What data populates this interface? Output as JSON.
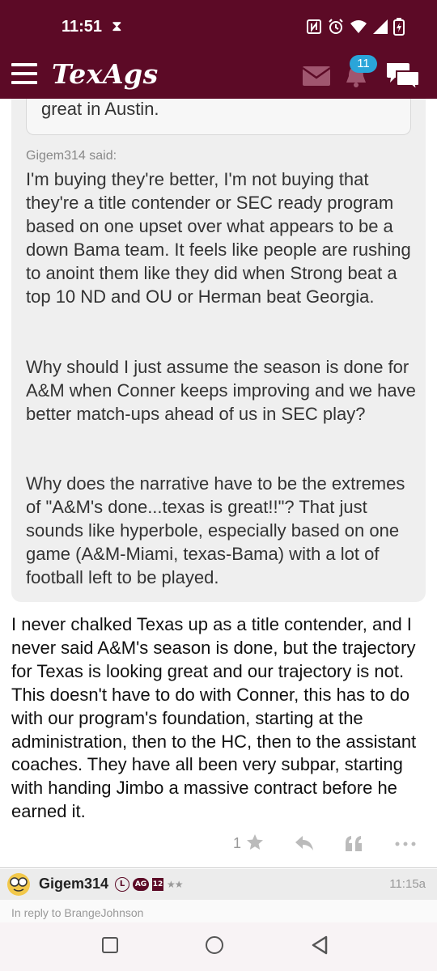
{
  "status_bar": {
    "time": "11:51",
    "hourglass_icon": "hourglass-icon",
    "icons": [
      "nfc-icon",
      "alarm-icon",
      "wifi-icon",
      "signal-icon",
      "battery-charging-icon"
    ]
  },
  "app_bar": {
    "logo": "TexAgs",
    "notification_count": "11",
    "icons": [
      "menu-icon",
      "mail-icon",
      "bell-icon",
      "chat-icon"
    ]
  },
  "colors": {
    "brand": "#5c0a26",
    "badge_blue": "#2aa5d9"
  },
  "quote": {
    "nested_tail": "great in Austin.",
    "author_label": "Gigem314 said:",
    "paragraphs": [
      "I'm buying they're better, I'm not buying that they're a title contender or SEC ready program based on one upset over what appears to be a down Bama team. It feels like people are rushing to anoint them like they did when Strong beat a top 10 ND and OU or Herman beat Georgia.",
      "Why should I just assume the season is done for A&M when Conner keeps improving and we have better match-ups ahead of us in SEC play?",
      "Why does the narrative have to be the extremes of \"A&M's done...texas is great!!\"? That just sounds like hyperbole, especially based on one game (A&M-Miami, texas-Bama) with a lot of football left to be played."
    ]
  },
  "post": {
    "body": "I never chalked Texas up as a title contender, and I never said A&M's season is done, but the trajectory for Texas is looking great and our trajectory is not. This doesn't have to do with Conner, this has to do with our program's foundation, starting at the administration, then to the HC, then to the assistant coaches. They have all been very subpar, starting with handing Jimbo a massive contract before he earned it.",
    "like_count": "1",
    "action_icons": [
      "star-icon",
      "reply-icon",
      "quote-icon",
      "more-icon"
    ]
  },
  "next_post": {
    "author": "Gigem314",
    "badge_l": "L",
    "badge_ag": "AG",
    "badge_12": "12",
    "stars": "★★",
    "time": "11:15a",
    "reply_to": "In reply to BrangeJohnson"
  },
  "nav_bar": {
    "icons": [
      "recents-icon",
      "home-icon",
      "back-icon"
    ]
  }
}
